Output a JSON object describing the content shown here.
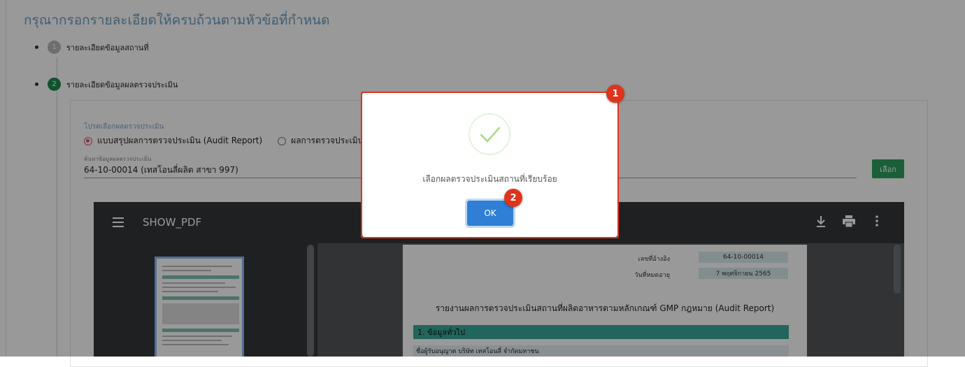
{
  "page": {
    "heading": "กรุณากรอกรายละเอียดให้ครบถ้วนตามหัวข้อที่กำหนด",
    "steps": [
      {
        "number": "1",
        "label": "รายละเอียดข้อมูลสถานที่"
      },
      {
        "number": "2",
        "label": "รายละเอียดข้อมูลผลตรวจประเมิน"
      }
    ]
  },
  "form": {
    "select_label": "โปรดเลือกผลตรวจประเมิน",
    "radio_options": [
      "แบบสรุปผลการตรวจประเมิน (Audit Report)",
      "ผลการตรวจประเมิน อื่น"
    ],
    "selected_option": "แบบสรุปผลการตรวจประเมิน (Audit Report)",
    "search_label": "ค้นหาข้อมูลผลตรวจประเมิน",
    "search_value": "64-10-00014 (เทสโอนลี่ผลิต สาขา 997)",
    "choose_button": "เลือก"
  },
  "pdf_viewer": {
    "title": "SHOW_PDF",
    "toolbar_icons": [
      "menu-icon",
      "download-icon",
      "print-icon",
      "more-vert-icon"
    ],
    "document": {
      "ref_label": "เลขที่อ้างอิง",
      "ref_value": "64-10-00014",
      "expiry_label": "วันที่หมดอายุ",
      "expiry_value": "7 พฤศจิกายน 2565",
      "title": "รายงานผลการตรวจประเมินสถานที่ผลิตอาหารตามหลักเกณฑ์ GMP กฎหมาย (Audit Report)",
      "section_1": "1. ข้อมูลทั่วไป",
      "licensee_row": "ชื่อผู้รับอนุญาต บริษัท เทสโอนลี่ จำกัดมหาชน"
    }
  },
  "modal": {
    "icon": "success-check-icon",
    "message": "เลือกผลตรวจประเมินสถานที่เรียบร้อย",
    "ok_button": "OK"
  },
  "annotations": {
    "marker_1": "1",
    "marker_2": "2"
  },
  "colors": {
    "accent_green": "#2e9e5e",
    "ok_blue": "#2f7fd6",
    "highlight_red": "#e0331c",
    "radio_pink": "#e04a6a"
  }
}
